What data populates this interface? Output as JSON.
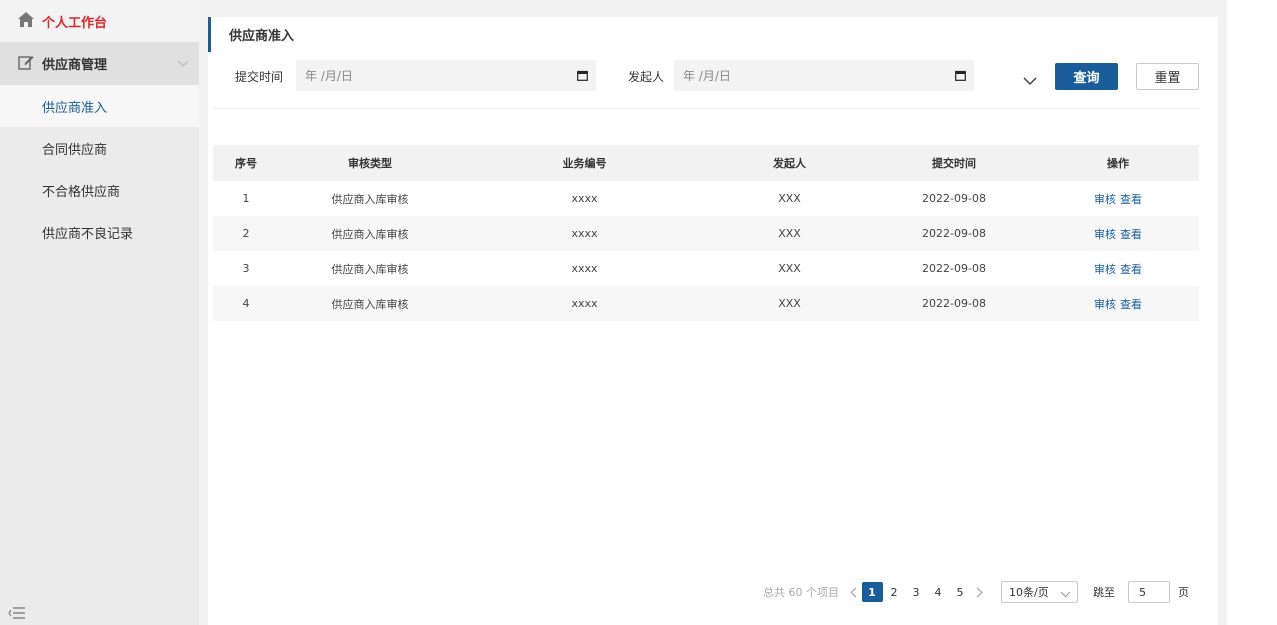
{
  "sidebar": {
    "home_label": "个人工作台",
    "group_label": "供应商管理",
    "items": [
      {
        "label": "供应商准入",
        "active": true
      },
      {
        "label": "合同供应商",
        "active": false
      },
      {
        "label": "不合格供应商",
        "active": false
      },
      {
        "label": "供应商不良记录",
        "active": false
      }
    ]
  },
  "page": {
    "title": "供应商准入"
  },
  "filters": {
    "submit_time_label": "提交时间",
    "submit_time_placeholder": "年 /月/日",
    "initiator_label": "发起人",
    "initiator_placeholder": "年 /月/日",
    "query_label": "查询",
    "reset_label": "重置"
  },
  "table": {
    "headers": [
      "序号",
      "审核类型",
      "业务编号",
      "发起人",
      "提交时间",
      "操作"
    ],
    "rows": [
      {
        "no": "1",
        "type": "供应商入库审核",
        "code": "xxxx",
        "initiator": "XXX",
        "time": "2022-09-08",
        "op1": "审核",
        "op2": "查看"
      },
      {
        "no": "2",
        "type": "供应商入库审核",
        "code": "xxxx",
        "initiator": "XXX",
        "time": "2022-09-08",
        "op1": "审核",
        "op2": "查看"
      },
      {
        "no": "3",
        "type": "供应商入库审核",
        "code": "xxxx",
        "initiator": "XXX",
        "time": "2022-09-08",
        "op1": "审核",
        "op2": "查看"
      },
      {
        "no": "4",
        "type": "供应商入库审核",
        "code": "xxxx",
        "initiator": "XXX",
        "time": "2022-09-08",
        "op1": "审核",
        "op2": "查看"
      }
    ]
  },
  "pagination": {
    "total_text": "总共 60 个项目",
    "pages": [
      "1",
      "2",
      "3",
      "4",
      "5"
    ],
    "current_page": "1",
    "page_size": "10条/页",
    "jump_label": "跳至",
    "jump_value": "5",
    "page_unit": "页"
  },
  "colors": {
    "accent": "#1a5d9a",
    "home_red": "#d9282f"
  }
}
